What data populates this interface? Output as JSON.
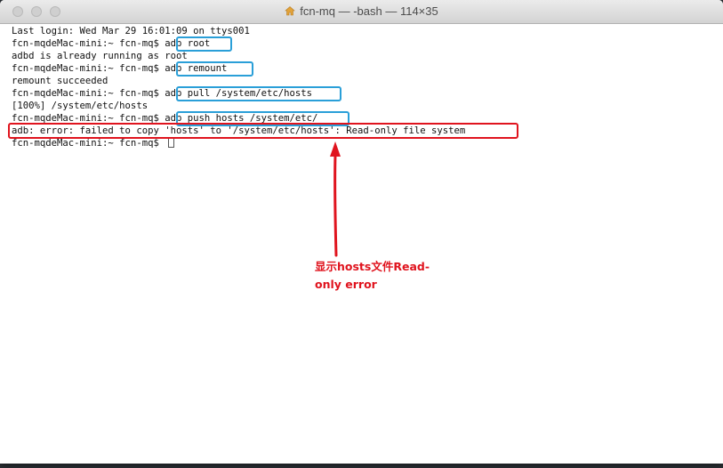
{
  "window": {
    "title": "fcn-mq — -bash — 114×35"
  },
  "terminal": {
    "lines": [
      {
        "prompt": "",
        "text": "Last login: Wed Mar 29 16:01:09 on ttys001"
      },
      {
        "prompt": "fcn-mqdeMac-mini:~ fcn-mq$ ",
        "text": "adb root"
      },
      {
        "prompt": "",
        "text": "adbd is already running as root"
      },
      {
        "prompt": "fcn-mqdeMac-mini:~ fcn-mq$ ",
        "text": "adb remount"
      },
      {
        "prompt": "",
        "text": "remount succeeded"
      },
      {
        "prompt": "fcn-mqdeMac-mini:~ fcn-mq$ ",
        "text": "adb pull /system/etc/hosts"
      },
      {
        "prompt": "",
        "text": "[100%] /system/etc/hosts"
      },
      {
        "prompt": "fcn-mqdeMac-mini:~ fcn-mq$ ",
        "text": "adb push hosts /system/etc/"
      },
      {
        "prompt": "",
        "text": "adb: error: failed to copy 'hosts' to '/system/etc/hosts': Read-only file system"
      },
      {
        "prompt": "fcn-mqdeMac-mini:~ fcn-mq$ ",
        "text": ""
      }
    ]
  },
  "annotation": {
    "line1": "显示hosts文件Read-",
    "line2": "only error",
    "color": "#e0141e"
  },
  "colors": {
    "command_highlight": "#2a9fd8",
    "error_highlight": "#e0141e"
  }
}
